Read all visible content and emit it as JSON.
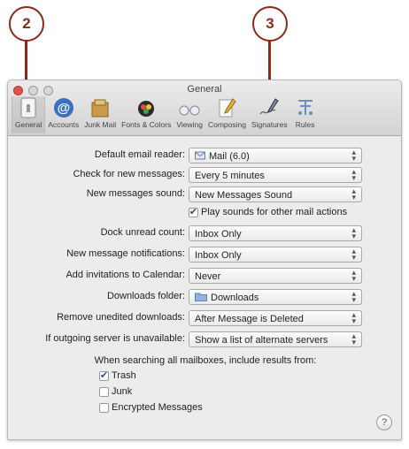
{
  "callouts": [
    {
      "label": "2"
    },
    {
      "label": "3"
    }
  ],
  "window": {
    "title": "General",
    "toolbar": [
      {
        "label": "General",
        "icon": "general-switch-icon"
      },
      {
        "label": "Accounts",
        "icon": "at-sign-icon"
      },
      {
        "label": "Junk Mail",
        "icon": "junk-mail-icon"
      },
      {
        "label": "Fonts & Colors",
        "icon": "fonts-colors-icon"
      },
      {
        "label": "Viewing",
        "icon": "glasses-icon"
      },
      {
        "label": "Composing",
        "icon": "composing-pencil-icon"
      },
      {
        "label": "Signatures",
        "icon": "signature-pen-icon"
      },
      {
        "label": "Rules",
        "icon": "rules-icon"
      }
    ]
  },
  "settings": {
    "default_email_reader": {
      "label": "Default email reader:",
      "value": "Mail (6.0)"
    },
    "check_new_messages": {
      "label": "Check for new messages:",
      "value": "Every 5 minutes"
    },
    "new_messages_sound": {
      "label": "New messages sound:",
      "value": "New Messages Sound"
    },
    "play_sounds": {
      "label": "Play sounds for other mail actions",
      "checked": true
    },
    "dock_unread_count": {
      "label": "Dock unread count:",
      "value": "Inbox Only"
    },
    "new_message_notifications": {
      "label": "New message notifications:",
      "value": "Inbox Only"
    },
    "add_invitations": {
      "label": "Add invitations to Calendar:",
      "value": "Never"
    },
    "downloads_folder": {
      "label": "Downloads folder:",
      "value": "Downloads"
    },
    "remove_unedited": {
      "label": "Remove unedited downloads:",
      "value": "After Message is Deleted"
    },
    "outgoing_unavailable": {
      "label": "If outgoing server is unavailable:",
      "value": "Show a list of alternate servers"
    }
  },
  "search": {
    "heading": "When searching all mailboxes, include results from:",
    "options": [
      {
        "label": "Trash",
        "checked": true
      },
      {
        "label": "Junk",
        "checked": false
      },
      {
        "label": "Encrypted Messages",
        "checked": false
      }
    ]
  },
  "help": {
    "label": "?"
  },
  "colors": {
    "callout": "#8b2a1c",
    "check": "#2a4f8f"
  }
}
